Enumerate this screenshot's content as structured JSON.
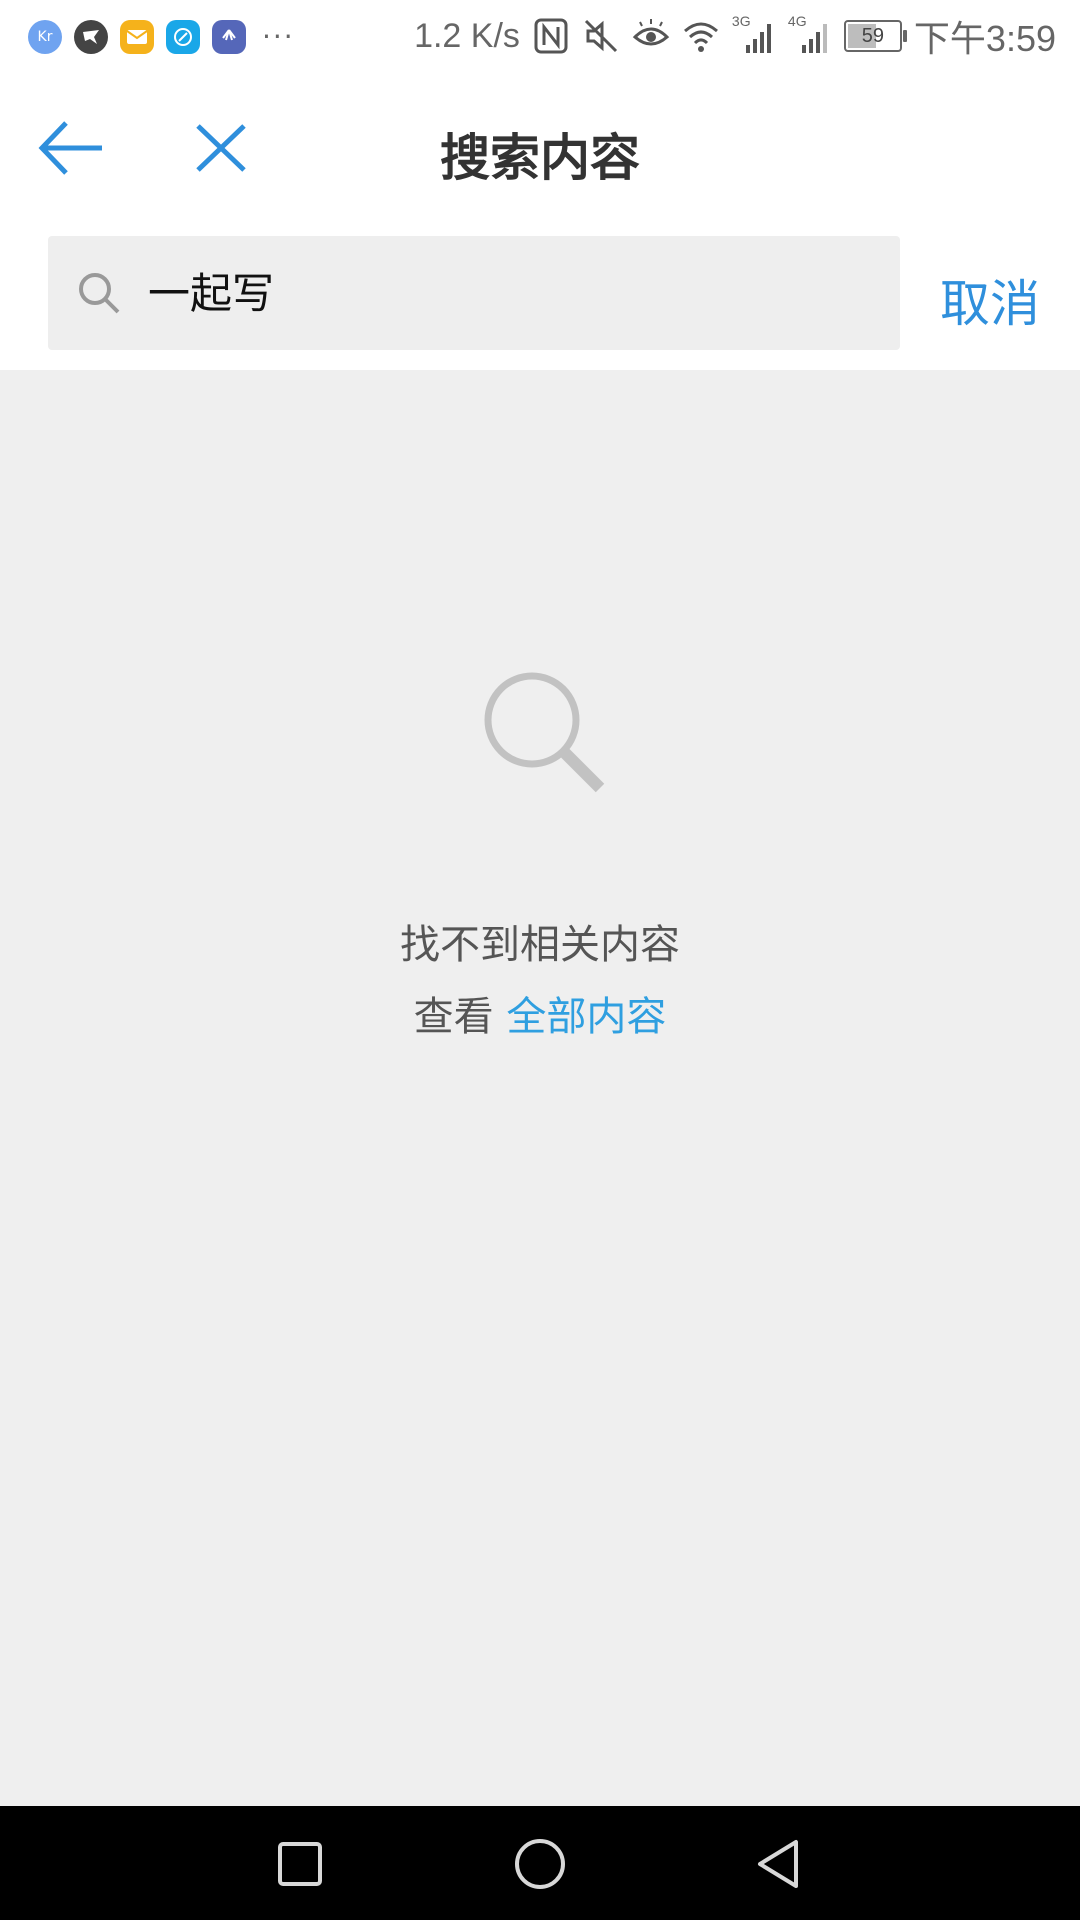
{
  "status_bar": {
    "net_speed": "1.2 K/s",
    "battery": "59",
    "battery_level": 0.59,
    "time": "下午3:59",
    "signal_3g": "3G",
    "signal_4g": "4G",
    "notification_icons": [
      "36kr-app-icon",
      "bird-app-icon",
      "mail-app-icon",
      "browser-app-icon",
      "huawei-app-icon"
    ],
    "more_indicator": "···"
  },
  "header": {
    "title": "搜索内容"
  },
  "search": {
    "query": "一起写",
    "cancel_label": "取消"
  },
  "empty_state": {
    "message": "找不到相关内容",
    "view_prefix": "查看 ",
    "view_link": "全部内容"
  },
  "colors": {
    "accent": "#2f8fdc",
    "link": "#2f9fe0",
    "background": "#efefef",
    "navbar": "#000000"
  }
}
